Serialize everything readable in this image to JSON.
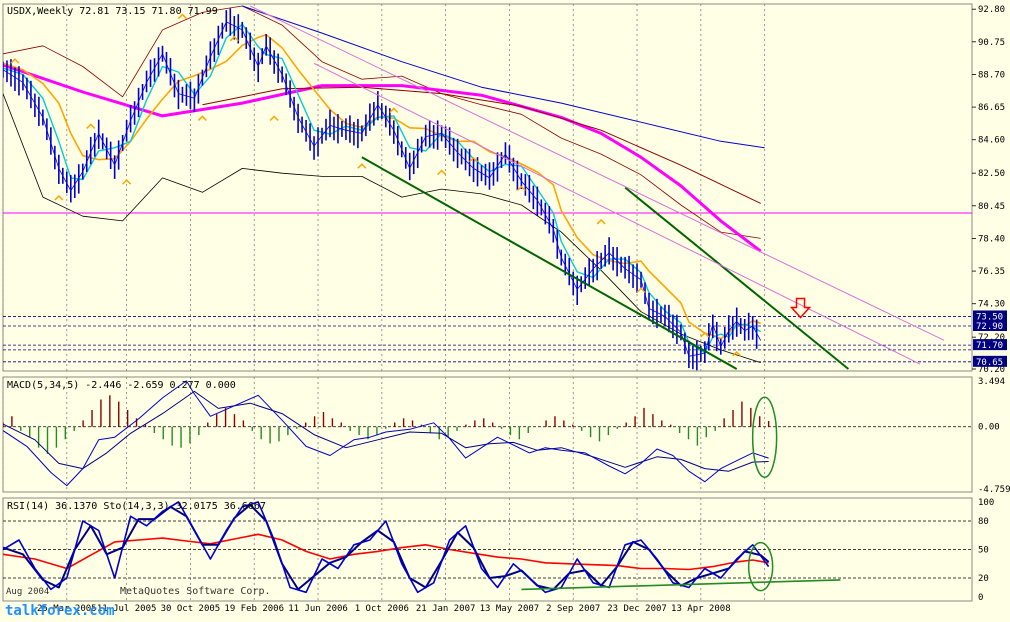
{
  "chart_data": [
    {
      "type": "line",
      "header": "USDX,Weekly  72.81 73.15 71.80 71.99",
      "y_ticks": [
        "92.80",
        "90.75",
        "88.70",
        "86.65",
        "84.60",
        "82.50",
        "80.45",
        "78.40",
        "76.35",
        "74.30",
        "72.20",
        "70.20"
      ],
      "ylim": [
        70.2,
        93.0
      ],
      "price_labels": [
        {
          "text": "73.50",
          "value": 73.5,
          "color": "#000080"
        },
        {
          "text": "72.90",
          "value": 72.9,
          "color": "#000080"
        },
        {
          "text": "71.70",
          "value": 71.7,
          "color": "#000080"
        },
        {
          "text": "70.65",
          "value": 70.65,
          "color": "#000080"
        }
      ],
      "h_lines": [
        73.5,
        72.9,
        71.7,
        71.4,
        70.65
      ],
      "x_dates": [
        "25 Mar 2005",
        "11 Jul 2005",
        "30 Oct 2005",
        "19 Feb 2006",
        "11 Jun 2006",
        "1 Oct 2006",
        "21 Jan 2007",
        "13 May 2007",
        "2 Sep 2007",
        "23 Dec 2007",
        "13 Apr 2008"
      ],
      "weeks": [
        0,
        16,
        31,
        47,
        63,
        79,
        95,
        111,
        127,
        143,
        159,
        175,
        191
      ],
      "close_series": {
        "color": "#0000CD",
        "x": [
          0,
          5,
          10,
          14,
          17,
          20,
          24,
          28,
          32,
          36,
          40,
          44,
          48,
          52,
          56,
          60,
          64,
          66,
          70,
          74,
          78,
          82,
          86,
          90,
          94,
          98,
          102,
          106,
          110,
          114,
          118,
          122,
          126,
          130,
          134,
          138,
          140,
          144,
          148,
          152,
          156,
          160,
          162,
          166,
          170,
          172,
          176,
          178,
          180,
          182,
          184,
          186,
          188,
          190
        ],
        "y": [
          89.0,
          88.2,
          86.0,
          82.8,
          81.4,
          82.6,
          85.0,
          83.0,
          85.8,
          88.2,
          90.0,
          87.5,
          87.2,
          89.8,
          92.0,
          91.5,
          89.2,
          90.5,
          88.7,
          86.0,
          84.2,
          85.5,
          85.2,
          85.0,
          86.8,
          85.2,
          82.8,
          84.8,
          85.0,
          83.8,
          82.8,
          82.2,
          83.7,
          82.0,
          80.8,
          79.0,
          77.2,
          75.2,
          76.5,
          77.5,
          76.5,
          75.8,
          74.0,
          73.5,
          72.5,
          71.0,
          71.2,
          73.0,
          71.6,
          72.6,
          73.2,
          72.6,
          72.9,
          71.99
        ]
      },
      "ma_series": [
        {
          "color": "#FF00FF",
          "x": [
            0,
            20,
            40,
            60,
            80,
            100,
            120,
            140,
            150,
            160,
            170,
            180,
            190
          ],
          "y": [
            89.3,
            87.6,
            86.1,
            86.9,
            88.0,
            88.0,
            87.4,
            86.0,
            85.0,
            83.5,
            81.7,
            79.5,
            77.6
          ]
        },
        {
          "color": "#0000CD",
          "x": [
            60,
            80,
            100,
            120,
            140,
            160,
            180,
            191
          ],
          "y": [
            93.0,
            91.3,
            89.5,
            87.9,
            86.9,
            85.7,
            84.5,
            84.1
          ]
        },
        {
          "color": "#8B0000",
          "x": [
            50,
            70,
            90,
            110,
            130,
            150,
            170,
            190
          ],
          "y": [
            86.8,
            87.8,
            87.9,
            87.5,
            86.7,
            85.2,
            83.0,
            80.6
          ]
        }
      ],
      "upper_band": {
        "color": "#8B0000",
        "x": [
          0,
          10,
          20,
          30,
          40,
          50,
          60,
          70,
          80,
          90,
          100,
          110,
          120,
          130,
          140,
          150,
          160,
          170,
          180,
          190
        ],
        "y": [
          90.0,
          90.5,
          89.2,
          87.3,
          91.5,
          92.6,
          93.0,
          91.8,
          89.5,
          88.4,
          88.6,
          87.5,
          86.8,
          86.2,
          84.7,
          83.7,
          82.4,
          80.5,
          78.8,
          78.4
        ]
      },
      "lower_band": {
        "color": "#000000",
        "x": [
          0,
          10,
          20,
          30,
          40,
          50,
          60,
          70,
          80,
          90,
          100,
          110,
          120,
          130,
          140,
          150,
          160,
          170,
          180,
          190
        ],
        "y": [
          87.5,
          81.0,
          79.8,
          79.5,
          82.2,
          81.3,
          82.8,
          82.5,
          82.3,
          82.3,
          81.0,
          81.5,
          81.2,
          80.5,
          78.8,
          76.4,
          73.8,
          72.4,
          71.4,
          70.6
        ]
      },
      "trendlines": [
        {
          "color": "#006400",
          "x": [
            90,
            184
          ],
          "y": [
            83.5,
            70.2
          ]
        },
        {
          "color": "#006400",
          "x": [
            156,
            212
          ],
          "y": [
            81.6,
            70.2
          ]
        },
        {
          "color": "#DA70D6",
          "x": [
            62,
            236
          ],
          "y": [
            93.0,
            72.0
          ]
        },
        {
          "color": "#DA70D6",
          "x": [
            78,
            230
          ],
          "y": [
            89.4,
            70.5
          ]
        }
      ],
      "horizontal_line": {
        "value": 80.0,
        "color": "#FF00FF"
      },
      "arrow_marker": {
        "x": 200,
        "y": 74.0,
        "color": "#FF0000"
      }
    },
    {
      "type": "line",
      "header": "MACD(5,34,5) -2.446 -2.659 0.277 0.000",
      "y_ticks": [
        "3.494",
        "0.00",
        "-4.759"
      ],
      "ylim": [
        -4.759,
        3.494
      ],
      "main_series": {
        "color": "#0000CD",
        "x": [
          0,
          6,
          12,
          16,
          20,
          24,
          28,
          34,
          40,
          46,
          48,
          52,
          58,
          64,
          70,
          76,
          82,
          88,
          92,
          96,
          102,
          108,
          112,
          116,
          120,
          124,
          128,
          132,
          136,
          140,
          146,
          152,
          156,
          160,
          164,
          168,
          172,
          176,
          180,
          184,
          188,
          192
        ],
        "y": [
          -0.3,
          -1.5,
          -3.5,
          -4.5,
          -3.2,
          -1.0,
          -0.8,
          0.6,
          2.2,
          3.5,
          2.5,
          0.8,
          1.6,
          2.4,
          0.5,
          -1.5,
          -2.2,
          -1.0,
          -0.8,
          -0.4,
          -0.2,
          0.3,
          -0.9,
          -2.4,
          -1.6,
          -0.8,
          -1.4,
          -2.0,
          -1.6,
          -1.8,
          -2.0,
          -3.0,
          -3.6,
          -2.8,
          -1.7,
          -2.2,
          -3.4,
          -4.2,
          -3.2,
          -2.6,
          -2.0,
          -2.4
        ]
      },
      "signal_series": {
        "color": "#000080",
        "x": [
          0,
          8,
          14,
          20,
          26,
          32,
          40,
          48,
          54,
          62,
          70,
          78,
          86,
          94,
          102,
          110,
          116,
          122,
          128,
          134,
          140,
          148,
          156,
          164,
          170,
          176,
          182,
          188,
          192
        ],
        "y": [
          0.2,
          -1.0,
          -2.8,
          -3.2,
          -2.0,
          -0.5,
          1.0,
          2.7,
          1.4,
          1.8,
          1.0,
          -0.6,
          -1.6,
          -1.0,
          -0.4,
          -0.5,
          -1.6,
          -1.3,
          -1.2,
          -1.8,
          -1.6,
          -2.3,
          -3.1,
          -2.3,
          -2.5,
          -3.2,
          -3.4,
          -2.7,
          -2.659
        ]
      },
      "histogram": [
        0.2,
        0.5,
        -0.2,
        -0.5,
        -1.0,
        -1.3,
        -1.0,
        -0.6,
        -0.2,
        0.3,
        0.8,
        1.3,
        1.5,
        1.2,
        0.8,
        0.4,
        0.1,
        -0.3,
        -0.6,
        -0.9,
        -1.0,
        -0.8,
        -0.4,
        0.2,
        0.6,
        0.9,
        0.6,
        0.3,
        -0.2,
        -0.6,
        -0.8,
        -0.7,
        -0.4,
        -0.1,
        0.2,
        0.5,
        0.7,
        0.4,
        0.2,
        -0.2,
        -0.4,
        -0.6,
        -0.4,
        -0.1,
        0.2,
        0.4,
        0.3,
        0.1,
        -0.3,
        -0.6,
        -0.5,
        -0.2,
        0.1,
        0.3,
        0.4,
        0.2,
        -0.1,
        -0.4,
        -0.6,
        -0.3,
        0.0,
        0.3,
        0.5,
        0.3,
        0.1,
        -0.2,
        -0.5,
        -0.7,
        -0.4,
        -0.1,
        0.2,
        0.5,
        0.9,
        0.6,
        0.3,
        0.1,
        -0.3,
        -0.6,
        -0.9,
        -0.5,
        -0.2,
        0.4,
        0.8,
        1.2,
        0.9,
        0.5,
        0.277
      ],
      "circle_marker": {
        "color": "#228B22"
      }
    },
    {
      "type": "line",
      "header": "RSI(14) 36.1370  Sto(14,3,3) 32.0175 36.6667",
      "y_ticks": [
        "100",
        "80",
        "50",
        "20",
        "0"
      ],
      "levels": [
        80,
        50,
        20
      ],
      "ylim": [
        0,
        100
      ],
      "rsi_series": {
        "color": "#FF0000",
        "x": [
          0,
          8,
          16,
          22,
          28,
          34,
          40,
          46,
          52,
          58,
          64,
          70,
          76,
          82,
          88,
          94,
          100,
          106,
          112,
          118,
          124,
          130,
          136,
          142,
          148,
          154,
          160,
          166,
          172,
          178,
          184,
          188,
          192
        ],
        "y": [
          45,
          40,
          30,
          44,
          58,
          60,
          62,
          59,
          56,
          61,
          66,
          60,
          48,
          40,
          45,
          48,
          52,
          55,
          50,
          46,
          42,
          40,
          36,
          35,
          34,
          33,
          30,
          30,
          29,
          32,
          37,
          39,
          36
        ]
      },
      "stoch_main": {
        "color": "#0000CD",
        "x": [
          0,
          4,
          8,
          12,
          16,
          20,
          24,
          28,
          32,
          36,
          40,
          44,
          48,
          52,
          56,
          60,
          64,
          68,
          72,
          76,
          80,
          84,
          88,
          92,
          96,
          100,
          104,
          108,
          112,
          116,
          120,
          124,
          128,
          132,
          136,
          140,
          144,
          148,
          152,
          156,
          160,
          164,
          168,
          172,
          176,
          180,
          184,
          188,
          192
        ],
        "y": [
          50,
          60,
          30,
          8,
          20,
          80,
          70,
          20,
          85,
          75,
          90,
          100,
          70,
          40,
          70,
          95,
          100,
          60,
          10,
          5,
          40,
          30,
          55,
          60,
          80,
          35,
          5,
          15,
          60,
          75,
          30,
          10,
          35,
          20,
          5,
          10,
          40,
          15,
          10,
          55,
          60,
          40,
          15,
          10,
          30,
          20,
          40,
          55,
          32
        ]
      },
      "stoch_signal": {
        "color": "#000080",
        "x": [
          0,
          5,
          10,
          14,
          18,
          22,
          26,
          30,
          34,
          38,
          42,
          46,
          50,
          54,
          58,
          62,
          66,
          70,
          74,
          78,
          82,
          86,
          90,
          94,
          98,
          102,
          106,
          110,
          114,
          118,
          122,
          126,
          130,
          134,
          138,
          142,
          146,
          150,
          154,
          158,
          162,
          166,
          170,
          174,
          178,
          182,
          186,
          190,
          192
        ],
        "y": [
          52,
          45,
          18,
          10,
          50,
          75,
          45,
          52,
          82,
          82,
          95,
          85,
          55,
          55,
          83,
          97,
          80,
          35,
          8,
          22,
          36,
          42,
          58,
          70,
          58,
          20,
          10,
          38,
          68,
          52,
          20,
          22,
          28,
          12,
          8,
          25,
          28,
          12,
          32,
          58,
          50,
          28,
          12,
          20,
          25,
          30,
          48,
          44,
          37
        ]
      },
      "green_line": {
        "color": "#228B22",
        "x": [
          130,
          210
        ],
        "y": [
          8,
          18
        ]
      },
      "circle_marker": {
        "color": "#228B22"
      }
    }
  ],
  "watermark": {
    "line1": "MetaQuotes Software Corp.",
    "line2": "talkforex.com",
    "line3": "Aug 2004"
  }
}
